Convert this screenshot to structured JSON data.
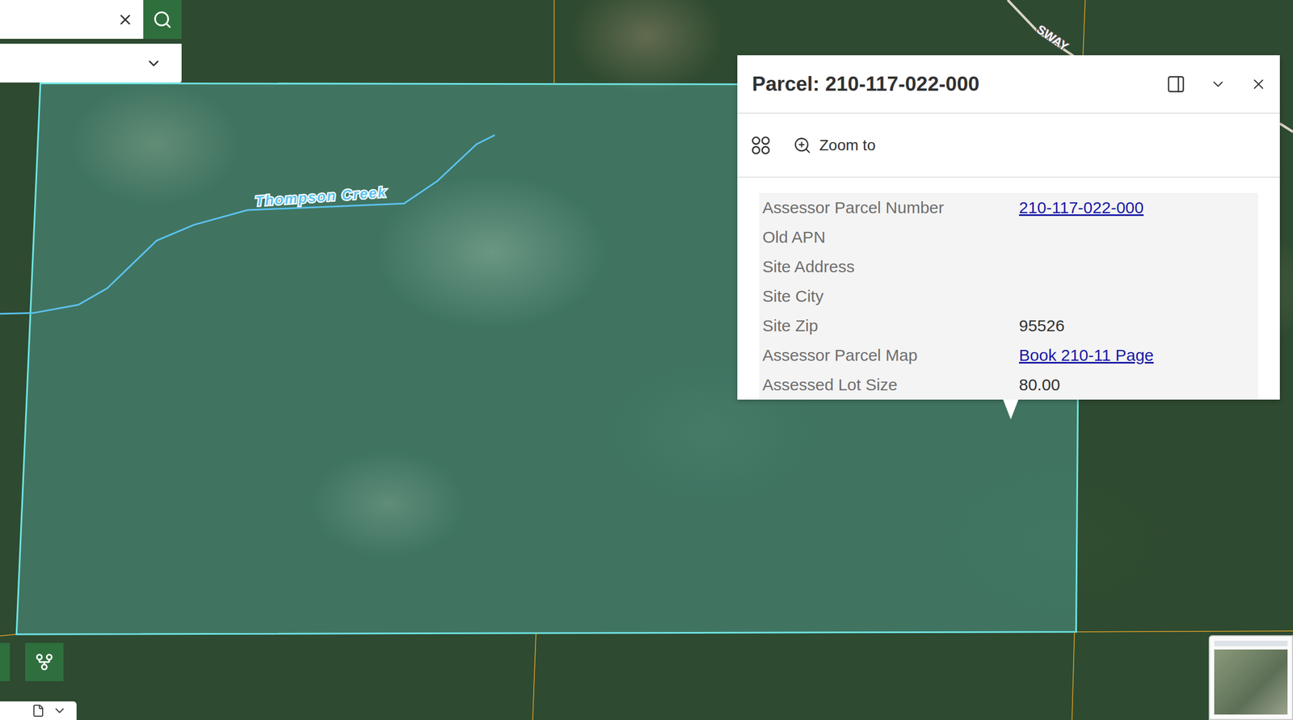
{
  "map": {
    "labels": [
      {
        "text": "Thompson Creek",
        "kind": "water"
      },
      {
        "text": "SWAY",
        "kind": "road"
      }
    ]
  },
  "search": {
    "value": ""
  },
  "layer_select": {
    "value": ""
  },
  "popup": {
    "title": "Parcel: 210-117-022-000",
    "toolbar": [
      {
        "label": "Zoom to"
      }
    ],
    "fields": [
      {
        "label": "Assessor Parcel Number",
        "value": "210-117-022-000",
        "link": true
      },
      {
        "label": "Old APN",
        "value": "",
        "link": false
      },
      {
        "label": "Site Address",
        "value": "",
        "link": false
      },
      {
        "label": "Site City",
        "value": "",
        "link": false
      },
      {
        "label": "Site Zip",
        "value": "95526",
        "link": false
      },
      {
        "label": "Assessor Parcel Map",
        "value": "Book 210-11 Page",
        "link": true
      },
      {
        "label": "Assessed Lot Size",
        "value": "80.00",
        "link": false
      }
    ]
  }
}
